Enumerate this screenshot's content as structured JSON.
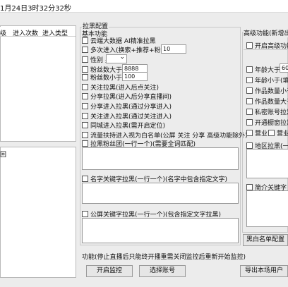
{
  "title": "1月24日3时32分32秒",
  "left_table": {
    "columns": [
      "级",
      "进入次数",
      "进入类型"
    ],
    "lower_list_item": "回"
  },
  "main": {
    "group_title": "拉黑配置",
    "basic_title": "基本功能",
    "options": [
      "云端大数据 AI精准拉黑",
      "多次进入(换索+推荐+粉丝)",
      "性别 男",
      "粉丝数大于",
      "粉丝数小于",
      "关注拉黑(进入后点关注)",
      "分享拉黑(进入后分享直播间)",
      "分享进入拉黑(通过分享进入)",
      "关注进入拉黑(通过关注进入)",
      "同城进入拉黑(需开启定位)",
      "流量扶持进入视为白名单(公屏 关注 分享 高级功能除外)",
      "拉黑粉丝团(一行一个)(需要全词匹配)"
    ],
    "multi_entry_value": "10",
    "gender_value": "男",
    "fans_gt_value": "8888",
    "fans_lt_value": "100",
    "name_keyword_label": "名字关键字拉黑(一行一个)(名字中包含指定文字)",
    "screen_keyword_label": "公屏关键字拉黑(一行一个)(包含指定文字拉黑)",
    "footer_note": "功能(停止直播后只能终开播重需关闭监控后重新开始监控)",
    "start_button": "开启监控",
    "select_account_button": "选择账号",
    "export_button": "导出本场用户"
  },
  "advanced": {
    "title": "高级功能(新增出",
    "items": [
      "开启高级功能",
      "年龄大于",
      "年龄小于(填",
      "作品数量小于",
      "作品数量大于",
      "私密账号拉黑",
      "开通橱窗拉黑",
      "营业",
      "地区拉黑(一行"
    ],
    "age_gt_value": "60",
    "business_label": "营业执照",
    "intro_keyword": "简介关键字",
    "blacklist_button": "黑白名单配置"
  }
}
